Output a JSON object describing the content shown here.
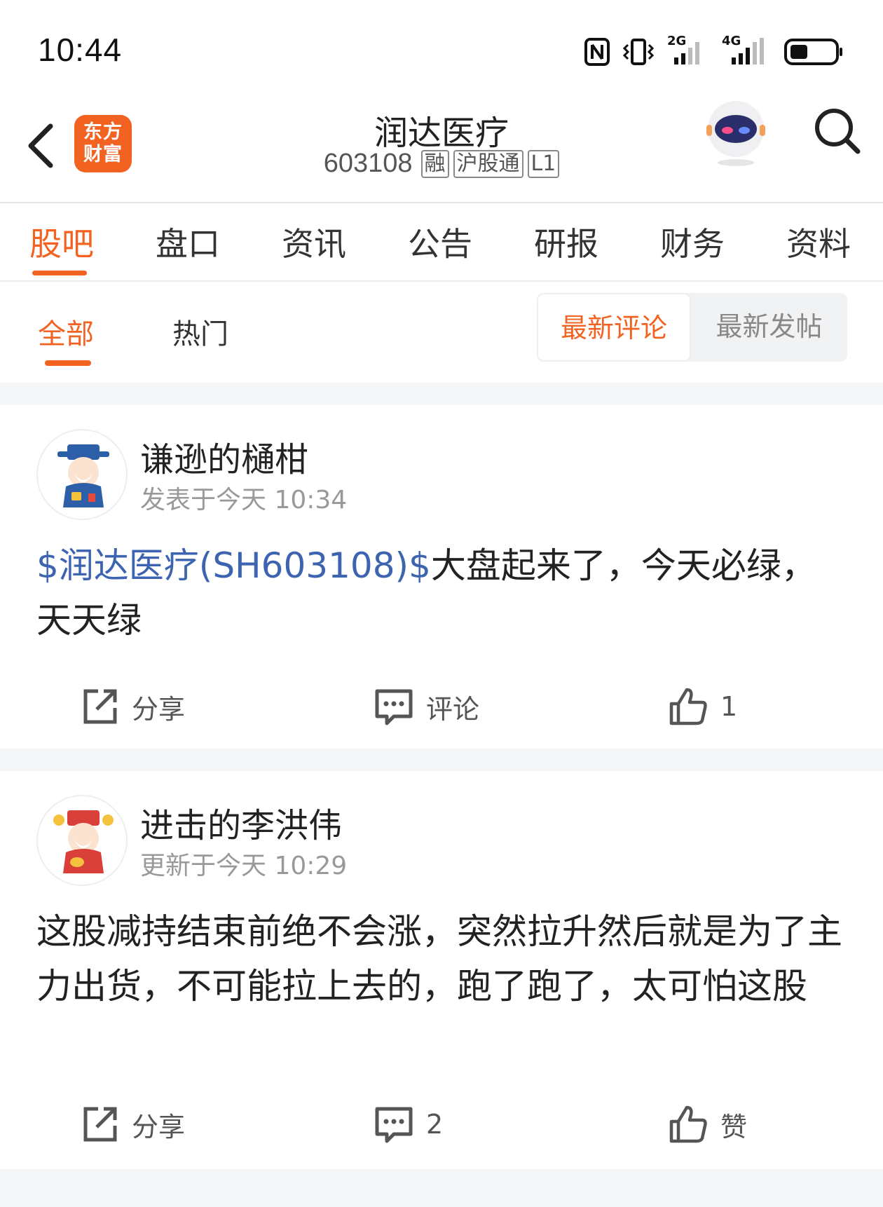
{
  "status_bar": {
    "time": "10:44",
    "network_1": "2G",
    "network_2": "4G",
    "icons": [
      "nfc-icon",
      "vibrate-icon",
      "signal-icon",
      "battery-icon"
    ]
  },
  "header": {
    "logo_line1": "东方",
    "logo_line2": "财富",
    "stock_name": "润达医疗",
    "stock_code": "603108",
    "tags": [
      "融",
      "沪股通",
      "L1"
    ]
  },
  "main_tabs": [
    {
      "label": "股吧",
      "active": true
    },
    {
      "label": "盘口",
      "active": false
    },
    {
      "label": "资讯",
      "active": false
    },
    {
      "label": "公告",
      "active": false
    },
    {
      "label": "研报",
      "active": false
    },
    {
      "label": "财务",
      "active": false
    },
    {
      "label": "资料",
      "active": false
    }
  ],
  "sub_tabs": {
    "all": "全部",
    "hot": "热门",
    "latest_comment": "最新评论",
    "latest_post": "最新发帖"
  },
  "posts": [
    {
      "author": "谦逊的樋柑",
      "time": "发表于今天 10:34",
      "stock_link": "$润达医疗(SH603108)$",
      "text": "大盘起来了，今天必绿，天天绿",
      "share": "分享",
      "comment": "评论",
      "like": "1"
    },
    {
      "author": "进击的李洪伟",
      "time": "更新于今天 10:29",
      "text": "这股减持结束前绝不会涨，突然拉升然后就是为了主力出货，不可能拉上去的，跑了跑了，太可怕这股",
      "share": "分享",
      "comment": "2",
      "like": "赞"
    }
  ],
  "colors": {
    "accent": "#f26322",
    "link": "#3c64b1"
  }
}
